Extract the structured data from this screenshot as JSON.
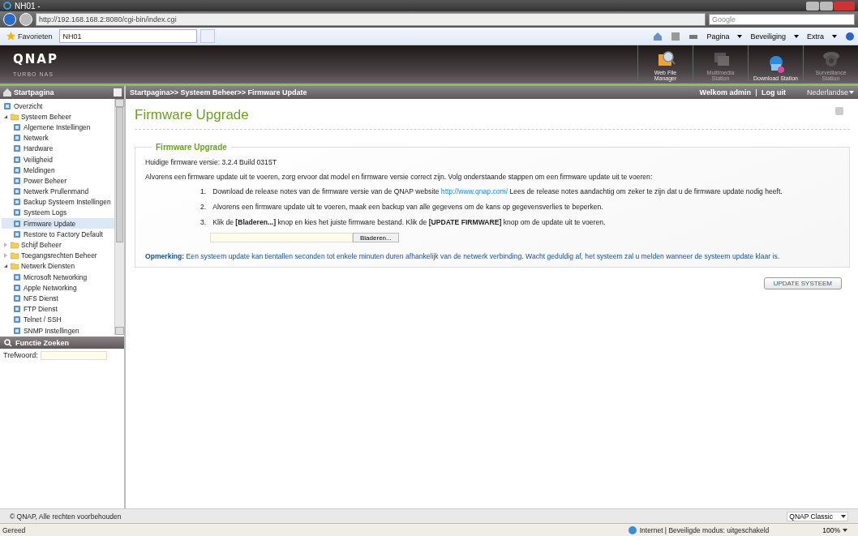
{
  "browser": {
    "title": "NH01 -",
    "url": "http://192.168.168.2:8080/cgi-bin/index.cgi",
    "search_placeholder": "Google",
    "favorites": "Favorieten",
    "tab": "NH01",
    "commands": [
      "Pagina",
      "Beveiliging",
      "Extra"
    ]
  },
  "header": {
    "logo": "QNAP",
    "subtitle": "TURBO NAS",
    "apps": [
      {
        "label": "Web File Manager",
        "disabled": false
      },
      {
        "label": "Multimedia Station",
        "disabled": true
      },
      {
        "label": "Download Station",
        "disabled": false
      },
      {
        "label": "Surveillance Station",
        "disabled": true
      }
    ]
  },
  "sidebar": {
    "title": "Startpagina",
    "tree": [
      {
        "label": "Overzicht",
        "kind": "page",
        "selected": false
      },
      {
        "label": "Systeem Beheer",
        "kind": "folder",
        "expanded": true,
        "selected": false,
        "children": [
          {
            "label": "Algemene Instellingen",
            "kind": "page",
            "selected": false
          },
          {
            "label": "Netwerk",
            "kind": "page",
            "selected": false
          },
          {
            "label": "Hardware",
            "kind": "page",
            "selected": false
          },
          {
            "label": "Veiligheid",
            "kind": "page",
            "selected": false
          },
          {
            "label": "Meldingen",
            "kind": "page",
            "selected": false
          },
          {
            "label": "Power Beheer",
            "kind": "page",
            "selected": false
          },
          {
            "label": "Netwerk Prullenmand",
            "kind": "page",
            "selected": false
          },
          {
            "label": "Backup Systeem Instellingen",
            "kind": "page",
            "selected": false
          },
          {
            "label": "Systeem Logs",
            "kind": "page",
            "selected": false
          },
          {
            "label": "Firmware Update",
            "kind": "page",
            "selected": true
          },
          {
            "label": "Restore to Factory Default",
            "kind": "page",
            "selected": false
          }
        ]
      },
      {
        "label": "Schijf Beheer",
        "kind": "folder",
        "expanded": false,
        "selected": false
      },
      {
        "label": "Toegangsrechten Beheer",
        "kind": "folder",
        "expanded": false,
        "selected": false
      },
      {
        "label": "Netwerk Diensten",
        "kind": "folder",
        "expanded": true,
        "selected": false,
        "children": [
          {
            "label": "Microsoft Networking",
            "kind": "page",
            "selected": false
          },
          {
            "label": "Apple Networking",
            "kind": "page",
            "selected": false
          },
          {
            "label": "NFS Dienst",
            "kind": "page",
            "selected": false
          },
          {
            "label": "FTP Dienst",
            "kind": "page",
            "selected": false
          },
          {
            "label": "Telnet / SSH",
            "kind": "page",
            "selected": false
          },
          {
            "label": "SNMP Instellingen",
            "kind": "page",
            "selected": false
          }
        ]
      }
    ],
    "search": {
      "title": "Functie Zoeken",
      "label": "Trefwoord:"
    }
  },
  "topbar": {
    "breadcrumb": "Startpagina>> Systeem Beheer>> Firmware Update",
    "welcome": "Welkom admin",
    "logout": "Log uit",
    "language": "Nederlandse"
  },
  "content": {
    "title": "Firmware Upgrade",
    "section": "Firmware Upgrade",
    "version": "Huidige firmware versie: 3.2.4 Build 0315T",
    "intro": "Alvorens een firmware update uit te voeren, zorg ervoor dat model en firmware versie correct zijn. Volg onderstaande stappen om een firmware update uit te voeren:",
    "steps": [
      {
        "number": "1.",
        "text": "Download de release notes van de firmware versie van de QNAP website",
        "link": "http://www.qnap.com/",
        "after": "Lees de release notes aandachtig om zeker te zijn dat u de firmware update nodig heeft."
      },
      {
        "number": "2.",
        "text": "Alvorens een firmware update uit te voeren, maak een backup van alle gegevens om de kans op gegevensverlies te beperken."
      },
      {
        "number": "3.",
        "text": "Klik de **[Bladeren...]** knop en kies het juiste firmware bestand. Klik de **[UPDATE FIRMWARE]** knop om de update uit te voeren."
      }
    ],
    "browse_button": "Bladeren...",
    "note": "**Opmerking:** Een systeem update kan tientallen seconden tot enkele minuten duren afhankelijk van de netwerk verbinding. Wacht geduldig af, het systeem zal u melden wanneer de systeem update klaar is.",
    "update_button": "UPDATE SYSTEEM"
  },
  "footer": {
    "copyright": "© QNAP, Alle rechten voorbehouden",
    "theme": "QNAP Classic"
  },
  "statusbar": {
    "status": "Gereed",
    "zone": "Internet | Beveiligde modus: uitgeschakeld",
    "zoom": "100%"
  }
}
